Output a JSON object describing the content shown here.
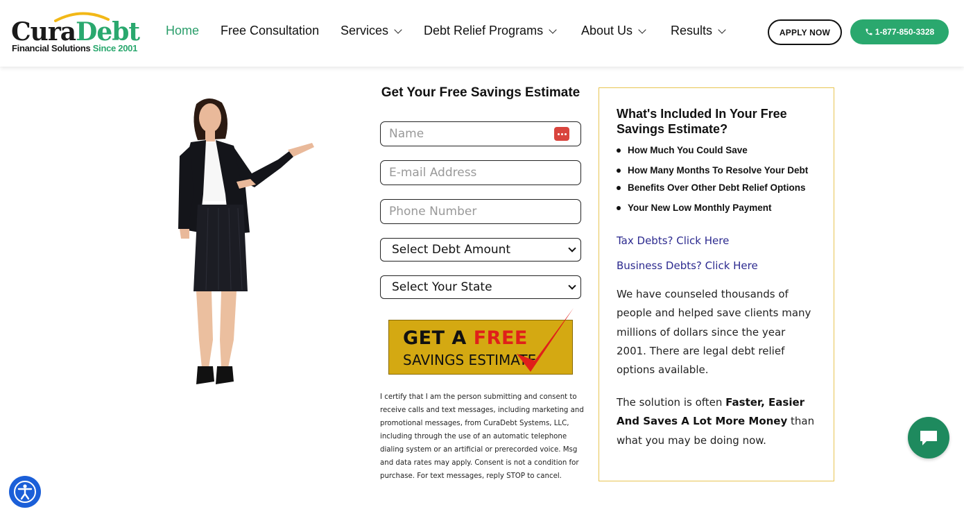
{
  "brand": {
    "name_part1": "Cura",
    "name_part2": "Debt",
    "tagline": "Financial Solutions",
    "tagline_since": "Since 2001",
    "accent_color": "#2aa86e",
    "arc_color": "#f2b817"
  },
  "nav": {
    "items": [
      {
        "label": "Home",
        "active": true,
        "dropdown": false
      },
      {
        "label": "Free Consultation",
        "active": false,
        "dropdown": false
      },
      {
        "label": "Services",
        "active": false,
        "dropdown": true
      },
      {
        "label": "Debt Relief Programs",
        "active": false,
        "dropdown": true
      },
      {
        "label": "About Us",
        "active": false,
        "dropdown": true
      },
      {
        "label": "Results",
        "active": false,
        "dropdown": true
      }
    ],
    "apply_label": "APPLY NOW",
    "phone_label": "1-877-850-3328",
    "phone_icon": "phone-icon"
  },
  "form": {
    "title": "Get Your Free Savings Estimate",
    "name_placeholder": "Name",
    "email_placeholder": "E-mail Address",
    "phone_placeholder": "Phone Number",
    "debt_select": "Select Debt Amount",
    "state_select": "Select Your State",
    "cta_line1_a": "GET A ",
    "cta_line1_b": "FREE",
    "cta_line2": "SAVINGS ESTIMATE",
    "cta_color": "#d4a912",
    "consent": "I certify that I am the person submitting and consent to receive calls and text messages, including marketing and promotional messages, from CuraDebt Systems, LLC, including through the use of an automatic telephone dialing system or an artificial or prerecorded voice. Msg and data rates may apply. Consent is not a condition for purchase. For text messages, reply STOP to cancel."
  },
  "info": {
    "title": "What's Included In Your Free Savings Estimate?",
    "bullets": [
      "How Much You Could Save",
      "How Many Months To Resolve Your Debt",
      "Benefits Over Other Debt Relief Options",
      "Your New Low Monthly Payment"
    ],
    "tax_link": "Tax Debts? Click Here",
    "business_link": "Business Debts? Click Here",
    "para1": "We have counseled thousands of people and helped save clients many millions of dollars since the year 2001. There are legal debt relief options available.",
    "para2_a": "The solution is often ",
    "para2_b": "Faster, Easier And Saves A Lot More Money",
    "para2_c": " than what you may be doing now.",
    "border_color": "#e8c552"
  },
  "floating": {
    "chat_icon": "chat-bubble-icon",
    "accessibility_icon": "accessibility-icon"
  }
}
